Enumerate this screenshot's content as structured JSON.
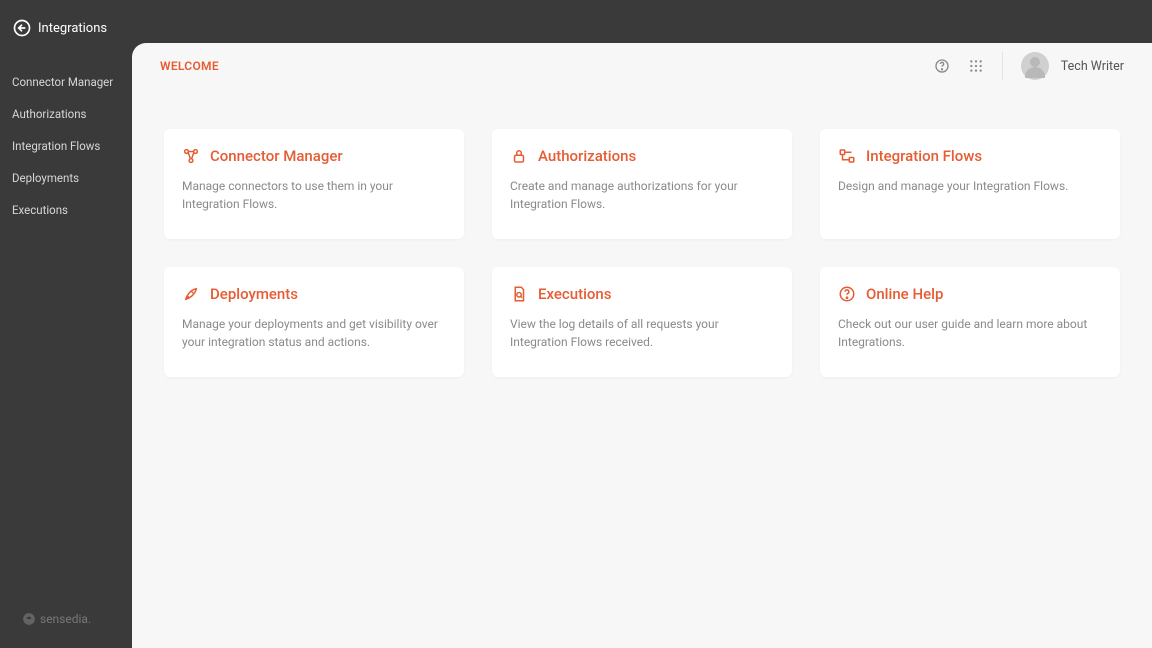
{
  "brand": {
    "name": "Integrations"
  },
  "footer_brand": "sensedia.",
  "sidebar": {
    "items": [
      {
        "label": "Connector Manager"
      },
      {
        "label": "Authorizations"
      },
      {
        "label": "Integration Flows"
      },
      {
        "label": "Deployments"
      },
      {
        "label": "Executions"
      }
    ]
  },
  "header": {
    "title": "WELCOME",
    "user_name": "Tech Writer"
  },
  "cards": [
    {
      "title": "Connector Manager",
      "desc": "Manage connectors to use them in your Integration Flows."
    },
    {
      "title": "Authorizations",
      "desc": "Create and manage authorizations for your Integration Flows."
    },
    {
      "title": "Integration Flows",
      "desc": "Design and manage your Integration Flows."
    },
    {
      "title": "Deployments",
      "desc": "Manage your deployments and get visibility over your integration status and actions."
    },
    {
      "title": "Executions",
      "desc": "View the log details of all requests your Integration Flows received."
    },
    {
      "title": "Online Help",
      "desc": "Check out our user guide and learn more about Integrations."
    }
  ]
}
